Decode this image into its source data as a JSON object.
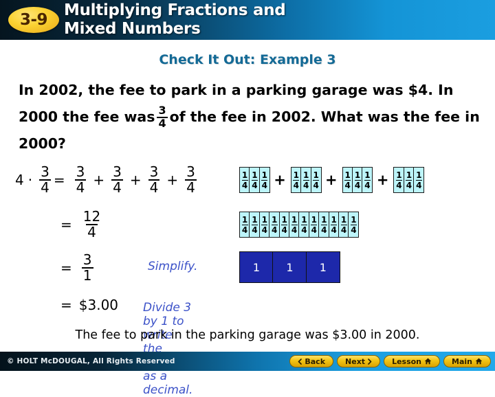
{
  "header": {
    "badge": "3-9",
    "title_line1": "Multiplying Fractions and",
    "title_line2": "Mixed Numbers"
  },
  "subtitle": "Check It Out: Example 3",
  "problem": {
    "part1": "In 2002, the fee to park in a parking garage was $4. In 2000 the fee was",
    "fraction": {
      "numerator": "3",
      "denominator": "4"
    },
    "part2": "of the fee in 2002. What was the fee in 2000?"
  },
  "work": {
    "row1": {
      "multiplier": "4",
      "dot": "·",
      "frac_a": {
        "numerator": "3",
        "denominator": "4"
      },
      "equals": "=",
      "terms": [
        {
          "numerator": "3",
          "denominator": "4"
        },
        {
          "numerator": "3",
          "denominator": "4"
        },
        {
          "numerator": "3",
          "denominator": "4"
        },
        {
          "numerator": "3",
          "denominator": "4"
        }
      ],
      "plus": "+"
    },
    "row2": {
      "equals": "=",
      "frac": {
        "numerator": "12",
        "denominator": "4"
      }
    },
    "row3": {
      "equals": "=",
      "frac": {
        "numerator": "3",
        "denominator": "1"
      },
      "note": "Simplify."
    },
    "row4": {
      "equals": "=",
      "value": "$3.00",
      "note": "Divide 3 by 1 to write the fraction as a decimal."
    }
  },
  "diagram": {
    "unit": {
      "numerator": "1",
      "denominator": "4"
    },
    "plus": "+",
    "row1_groups": 4,
    "row1_cells_per_group": 3,
    "row2_cells": 12,
    "row3_wholes": [
      "1",
      "1",
      "1"
    ],
    "colors": {
      "fraction_cell_fill": "#bdf5fa",
      "whole_cell_fill": "#1d28aa",
      "cell_border": "#1a1a1a"
    }
  },
  "conclusion": "The fee to park in the parking garage was $3.00 in 2000.",
  "footer": {
    "copyright": "© HOLT McDOUGAL, All Rights Reserved",
    "buttons": [
      {
        "label": "Back",
        "icon": "chevron-left-icon"
      },
      {
        "label": "Next",
        "icon": "chevron-right-icon"
      },
      {
        "label": "Lesson",
        "icon": "home-icon"
      },
      {
        "label": "Main",
        "icon": "home-icon"
      }
    ]
  }
}
